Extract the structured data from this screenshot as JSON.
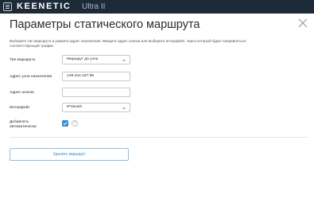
{
  "header": {
    "brand": "KEENETIC",
    "model": "Ultra II"
  },
  "dialog": {
    "title": "Параметры статического маршрута",
    "description": "Выберите тип маршрута и укажите адрес назначения. Введите адрес шлюза или выберите интерфейс, через который будет направляться соответствующий трафик.",
    "fields": {
      "route_type": {
        "label": "Тип маршрута",
        "value": "Маршрут до узла"
      },
      "dest_address": {
        "label": "Адрес узла назначения",
        "value": "149.154.167.99"
      },
      "gateway": {
        "label": "Адрес шлюза",
        "value": ""
      },
      "interface": {
        "label": "Интерфейс",
        "value": "IPVanish"
      },
      "auto_add": {
        "label": "Добавлять автоматически",
        "checked": true,
        "help": "?"
      }
    },
    "delete_button": "Удалить маршрут"
  },
  "icons": {
    "menu": "menu-icon",
    "close": "close-icon",
    "chevron": "chevron-down-icon",
    "check": "check-icon",
    "help": "help-icon"
  },
  "colors": {
    "topbar": "#1d2a37",
    "accent": "#2d8ed4"
  }
}
